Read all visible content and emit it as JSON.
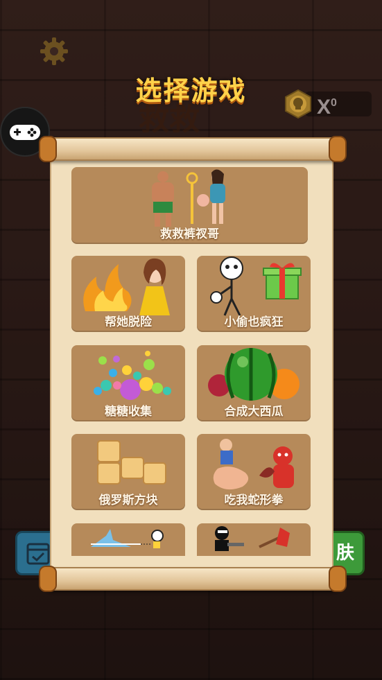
{
  "screen": {
    "title": "选择游戏",
    "background_logo": "救救",
    "coin_count": "0",
    "coin_prefix": "X",
    "right_button_label": "肤"
  },
  "games": [
    {
      "label": "救救裤衩哥",
      "icon": "rescue-icon"
    },
    {
      "label": "帮她脱险",
      "icon": "fire-princess-icon"
    },
    {
      "label": "小偷也疯狂",
      "icon": "thief-gift-icon"
    },
    {
      "label": "糖糖收集",
      "icon": "candy-balls-icon"
    },
    {
      "label": "合成大西瓜",
      "icon": "watermelon-icon"
    },
    {
      "label": "俄罗斯方块",
      "icon": "wood-blocks-icon"
    },
    {
      "label": "吃我蛇形拳",
      "icon": "snake-fist-icon"
    },
    {
      "label": "",
      "icon": "stickman-icon"
    },
    {
      "label": "",
      "icon": "ninja-icon"
    }
  ],
  "colors": {
    "title": "#ffd24a",
    "card": "#b68a5a",
    "paper": "#f1dfbd"
  }
}
